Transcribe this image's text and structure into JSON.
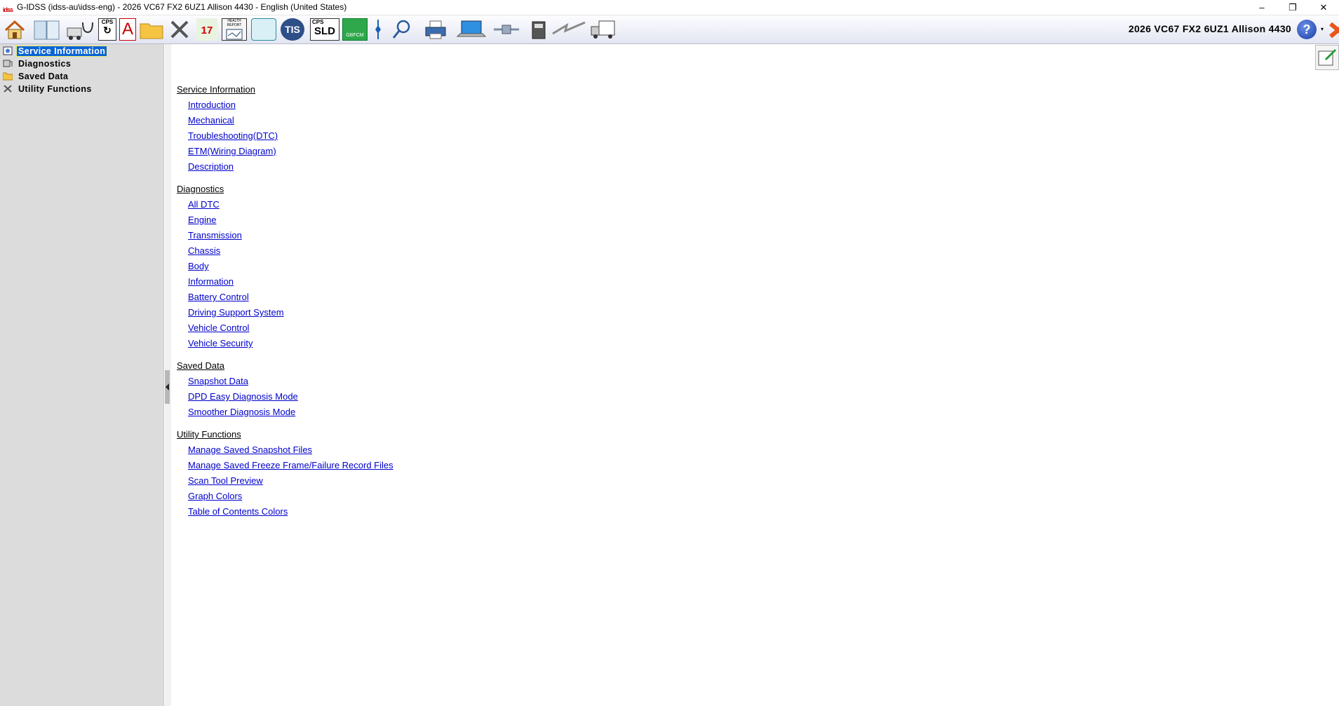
{
  "window": {
    "title": "G-IDSS (idss-au\\idss-eng) - 2026 VC67 FX2 6UZ1 Allison 4430 - English (United States)",
    "app_icon_text": "idss",
    "minimize": "–",
    "restore": "❐",
    "close": "✕"
  },
  "toolbar": {
    "vehicle_label": "2026 VC67 FX2 6UZ1 Allison 4430",
    "buttons": [
      {
        "name": "home-icon"
      },
      {
        "name": "book-icon"
      },
      {
        "name": "truck-stethoscope-icon"
      },
      {
        "name": "cps-reprogram-icon",
        "text": "CPS"
      },
      {
        "name": "font-a-icon",
        "text": "A"
      },
      {
        "name": "folder-icon"
      },
      {
        "name": "tools-icon"
      },
      {
        "name": "calendar-17-icon",
        "text": "17"
      },
      {
        "name": "health-report-icon",
        "text": "HEALTH REPORT"
      },
      {
        "name": "dashboard-monitor-icon"
      },
      {
        "name": "tis-icon",
        "text": "TIS"
      },
      {
        "name": "cps-sld-icon",
        "text_top": "CPS",
        "text": "SLD"
      },
      {
        "name": "gbfcm-icon",
        "text": "GBFCM"
      },
      {
        "name": "divider-pin-icon"
      },
      {
        "name": "magnifier-icon"
      },
      {
        "name": "printer-icon"
      },
      {
        "name": "laptop-icon"
      },
      {
        "name": "connector-icon"
      },
      {
        "name": "device-icon"
      },
      {
        "name": "lightning-icon"
      },
      {
        "name": "truck-icon"
      }
    ],
    "help_text": "?",
    "help_caret": "▾"
  },
  "tree": {
    "items": [
      {
        "label": "Service Information",
        "icon": "book-icon",
        "selected": true
      },
      {
        "label": "Diagnostics",
        "icon": "diagnostics-icon",
        "selected": false
      },
      {
        "label": "Saved Data",
        "icon": "folder-icon",
        "selected": false
      },
      {
        "label": "Utility Functions",
        "icon": "tools-icon",
        "selected": false
      }
    ]
  },
  "sections": [
    {
      "title": "Service Information",
      "links": [
        "Introduction",
        "Mechanical",
        "Troubleshooting(DTC)",
        "ETM(Wiring Diagram)",
        "Description"
      ]
    },
    {
      "title": "Diagnostics",
      "links": [
        "All DTC",
        "Engine",
        "Transmission",
        "Chassis",
        "Body",
        "Information",
        "Battery Control",
        "Driving Support System",
        "Vehicle Control",
        "Vehicle Security"
      ]
    },
    {
      "title": "Saved Data",
      "links": [
        "Snapshot Data",
        "DPD Easy Diagnosis Mode",
        "Smoother Diagnosis Mode"
      ]
    },
    {
      "title": "Utility Functions",
      "links": [
        "Manage Saved Snapshot Files",
        "Manage Saved Freeze Frame/Failure Record Files",
        "Scan Tool Preview",
        "Graph Colors",
        "Table of Contents Colors"
      ]
    }
  ],
  "colors": {
    "link": "#0000cc",
    "selection": "#0a64d6",
    "tree_bg": "#dcdcdc"
  }
}
